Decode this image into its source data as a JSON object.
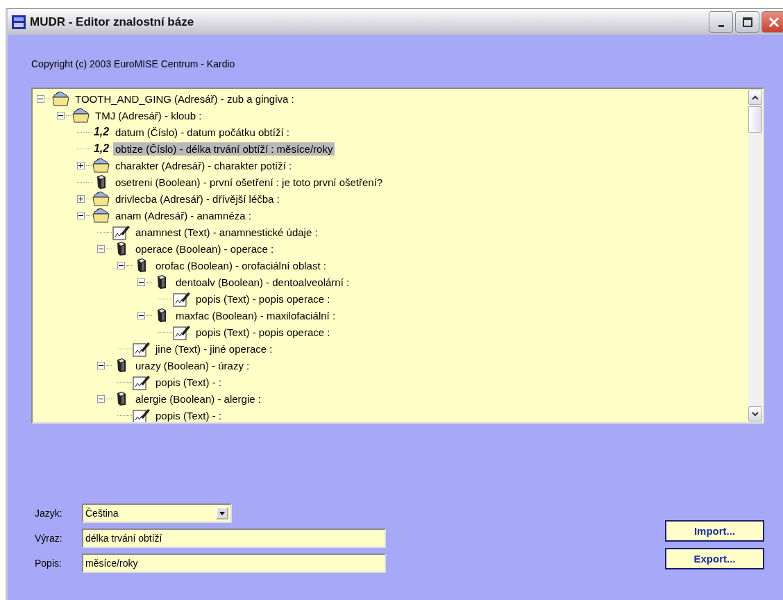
{
  "window": {
    "title": "MUDR - Editor znalostní báze"
  },
  "copyright": "Copyright (c) 2003 EuroMISE Centrum - Kardio",
  "tree": [
    {
      "kind": "folder",
      "label": "TOOTH_AND_GING (Adresář) - zub a gingiva :",
      "selected": false,
      "expanded": true,
      "children": [
        {
          "kind": "folder",
          "label": "TMJ (Adresář) - kloub :",
          "selected": false,
          "expanded": true,
          "children": [
            {
              "kind": "number",
              "badge": "1,2",
              "label": "datum (Číslo) - datum počátku obtíží :",
              "selected": false
            },
            {
              "kind": "number",
              "badge": "1,2",
              "label": "obtize (Číslo) - délka trvání obtíží : měsíce/roky",
              "selected": true
            },
            {
              "kind": "folder",
              "label": "charakter (Adresář) - charakter potíží :",
              "selected": false,
              "expanded": false
            },
            {
              "kind": "boolean",
              "label": "osetreni (Boolean) - první ošetření : je toto první ošetření?",
              "selected": false
            },
            {
              "kind": "folder",
              "label": "drivlecba (Adresář) - dřívější léčba :",
              "selected": false,
              "expanded": false
            },
            {
              "kind": "folder",
              "label": "anam (Adresář) - anamnéza :",
              "selected": false,
              "expanded": true,
              "children": [
                {
                  "kind": "text",
                  "label": "anamnest (Text) - anamnestické údaje :",
                  "selected": false
                },
                {
                  "kind": "boolean",
                  "label": "operace (Boolean) - operace :",
                  "selected": false,
                  "expanded": true,
                  "children": [
                    {
                      "kind": "boolean",
                      "label": "orofac (Boolean) - orofaciální oblast :",
                      "selected": false,
                      "expanded": true,
                      "children": [
                        {
                          "kind": "boolean",
                          "label": "dentoalv (Boolean) - dentoalveolární :",
                          "selected": false,
                          "expanded": true,
                          "children": [
                            {
                              "kind": "text",
                              "label": "popis (Text) - popis operace :",
                              "selected": false
                            }
                          ]
                        },
                        {
                          "kind": "boolean",
                          "label": "maxfac (Boolean) - maxilofaciální :",
                          "selected": false,
                          "expanded": true,
                          "children": [
                            {
                              "kind": "text",
                              "label": "popis (Text) - popis operace :",
                              "selected": false
                            }
                          ]
                        }
                      ]
                    },
                    {
                      "kind": "text",
                      "label": "jine (Text) - jiné operace :",
                      "selected": false
                    }
                  ]
                },
                {
                  "kind": "boolean",
                  "label": "urazy (Boolean) - úrazy :",
                  "selected": false,
                  "expanded": true,
                  "children": [
                    {
                      "kind": "text",
                      "label": "popis (Text) - :",
                      "selected": false
                    }
                  ]
                },
                {
                  "kind": "boolean",
                  "label": "alergie (Boolean) - alergie :",
                  "selected": false,
                  "expanded": true,
                  "children": [
                    {
                      "kind": "text",
                      "label": "popis (Text) - :",
                      "selected": false
                    }
                  ]
                }
              ]
            }
          ]
        }
      ]
    }
  ],
  "form": {
    "language": {
      "label": "Jazyk:",
      "value": "Čeština"
    },
    "fields": [
      {
        "label": "Výraz:",
        "value": "délka trvání obtíží"
      },
      {
        "label": "Popis:",
        "value": "měsíce/roky"
      }
    ],
    "buttons": [
      "Import...",
      "Export..."
    ]
  }
}
